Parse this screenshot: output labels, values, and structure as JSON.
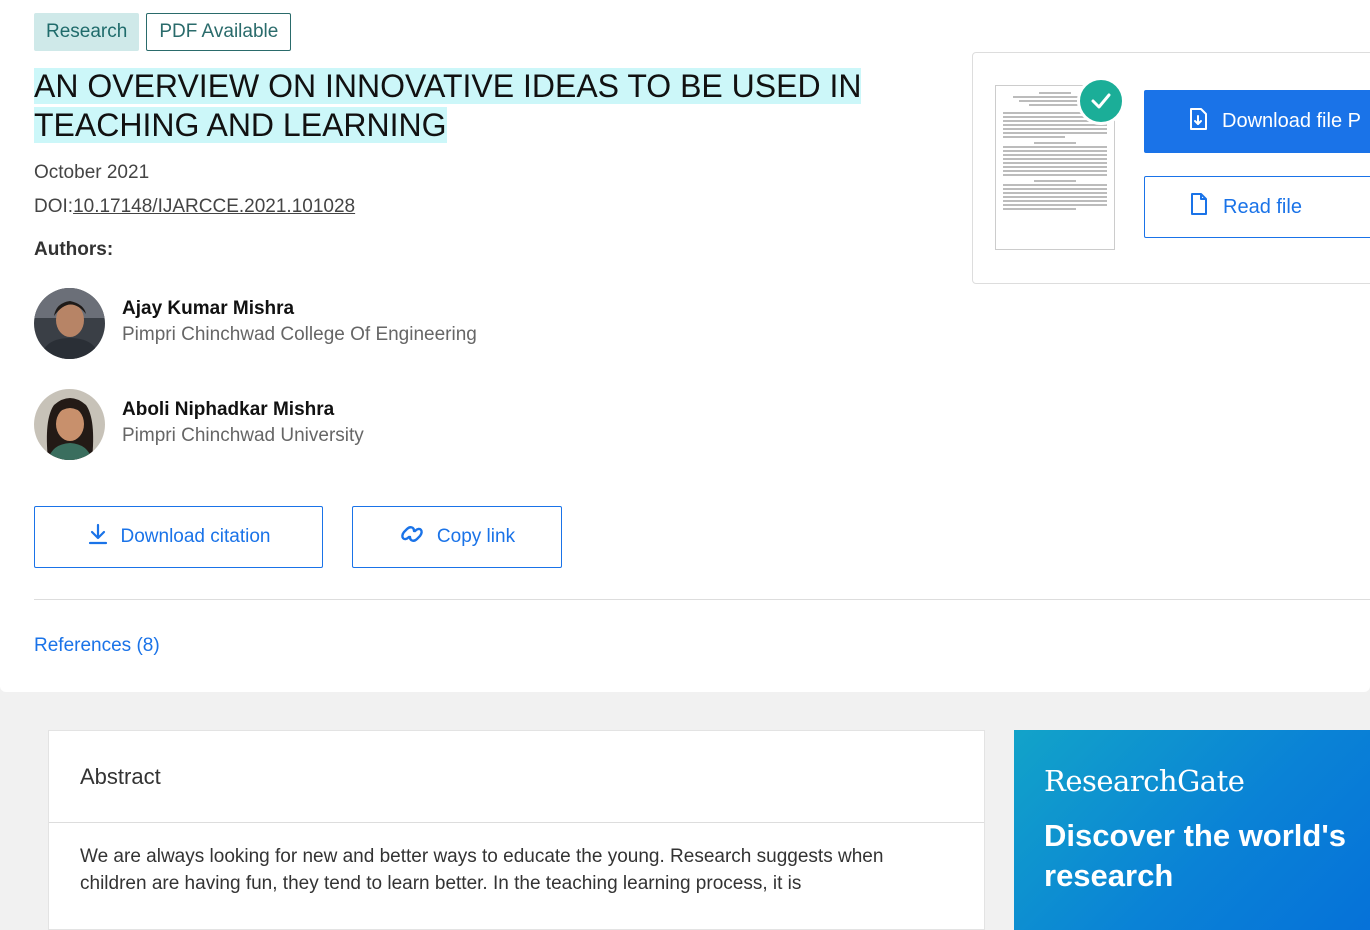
{
  "tags": {
    "type": "Research",
    "availability": "PDF Available"
  },
  "title": "AN OVERVIEW ON INNOVATIVE IDEAS TO BE USED IN TEACHING AND LEARNING",
  "date": "October 2021",
  "doi": {
    "prefix": "DOI:",
    "value": "10.17148/IJARCCE.2021.101028"
  },
  "authors_label": "Authors:",
  "authors": [
    {
      "name": "Ajay Kumar Mishra",
      "affiliation": "Pimpri Chinchwad College Of Engineering"
    },
    {
      "name": "Aboli Niphadkar Mishra",
      "affiliation": "Pimpri Chinchwad University"
    }
  ],
  "actions": {
    "download_citation": "Download citation",
    "copy_link": "Copy link"
  },
  "references_link": "References (8)",
  "file_panel": {
    "download_label": "Download file P",
    "read_label": "Read file"
  },
  "abstract": {
    "heading": "Abstract",
    "text": "We are always looking for new and better ways to educate the young. Research suggests when children are having fun, they tend to learn better. In the teaching learning process, it is"
  },
  "promo": {
    "logo": "ResearchGate",
    "headline": "Discover the world's research"
  },
  "colors": {
    "accent": "#1a73e8",
    "teal": "#1bae98",
    "highlight": "#ccf7f9"
  }
}
